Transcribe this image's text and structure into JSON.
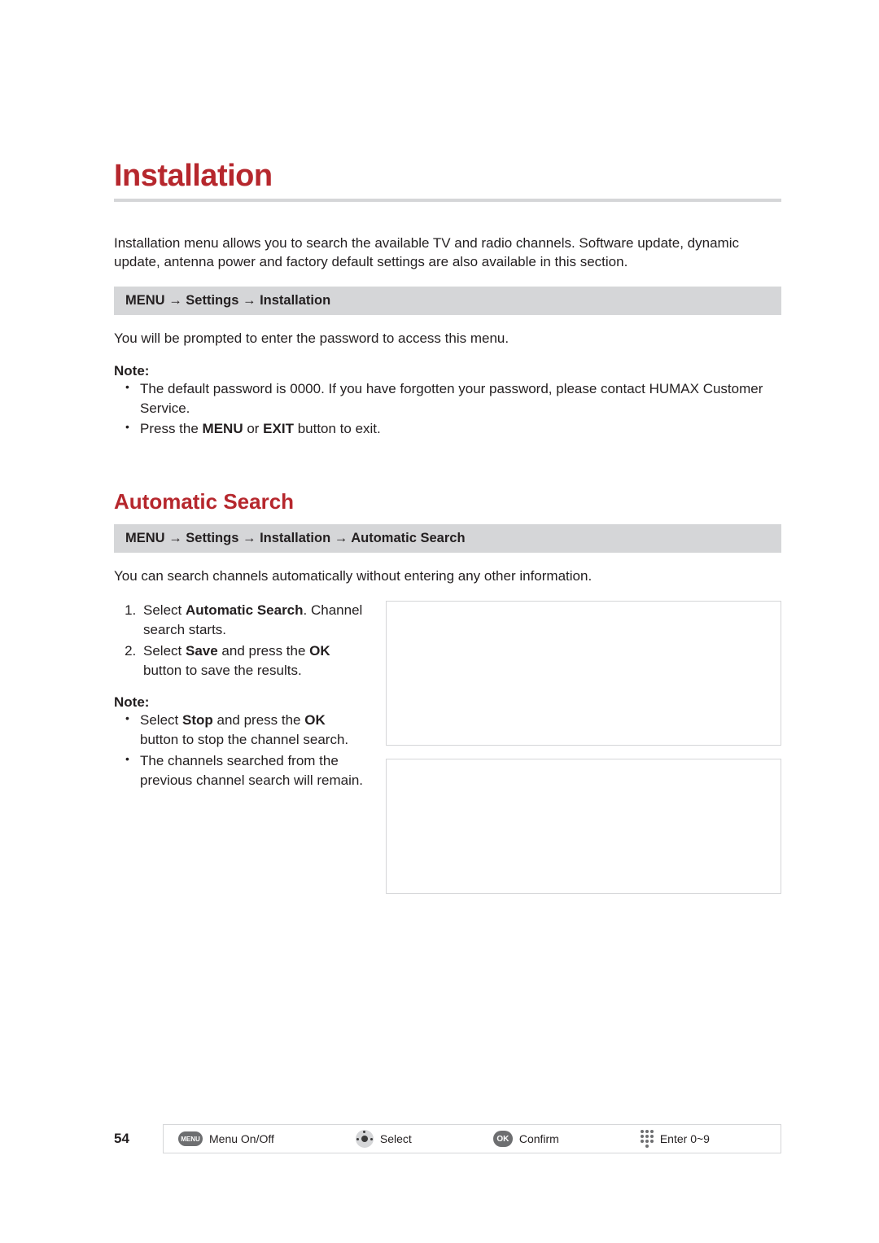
{
  "chapter_title": "Installation",
  "intro": "Installation menu allows you to search the available TV and radio channels. Software update, dynamic update, antenna power and factory default settings are also available in this section.",
  "nav1": {
    "menu": "MENU",
    "settings": "Settings",
    "installation": "Installation"
  },
  "prompt": "You will be prompted to enter the password to access this menu.",
  "note_label": "Note:",
  "note1_a_pre": "The default password is 0000. If you have forgotten your password, please contact HUMAX Customer Service.",
  "note1_b_pre": "Press the ",
  "note1_b_b1": "MENU",
  "note1_b_mid": " or ",
  "note1_b_b2": "EXIT",
  "note1_b_post": " button to exit.",
  "section_title": "Automatic Search",
  "nav2_auto": "Automatic Search",
  "search_intro": "You can search channels automatically without entering any other information.",
  "step1_pre": "Select ",
  "step1_b": "Automatic Search",
  "step1_post": ". Channel search starts.",
  "step2_pre": "Select ",
  "step2_b1": "Save",
  "step2_mid": " and press the ",
  "step2_b2": "OK",
  "step2_post": " button to save the results.",
  "note2_a_pre": "Select ",
  "note2_a_b1": "Stop",
  "note2_a_mid": " and press the ",
  "note2_a_b2": "OK",
  "note2_a_post": " button to stop the channel search.",
  "note2_b": "The channels searched from the previous channel search will remain.",
  "page_number": "54",
  "legend": {
    "menu": "Menu On/Off",
    "select": "Select",
    "confirm": "Confirm",
    "enter": "Enter 0~9",
    "menu_btn": "MENU",
    "ok_btn": "OK"
  },
  "arrow": "→"
}
